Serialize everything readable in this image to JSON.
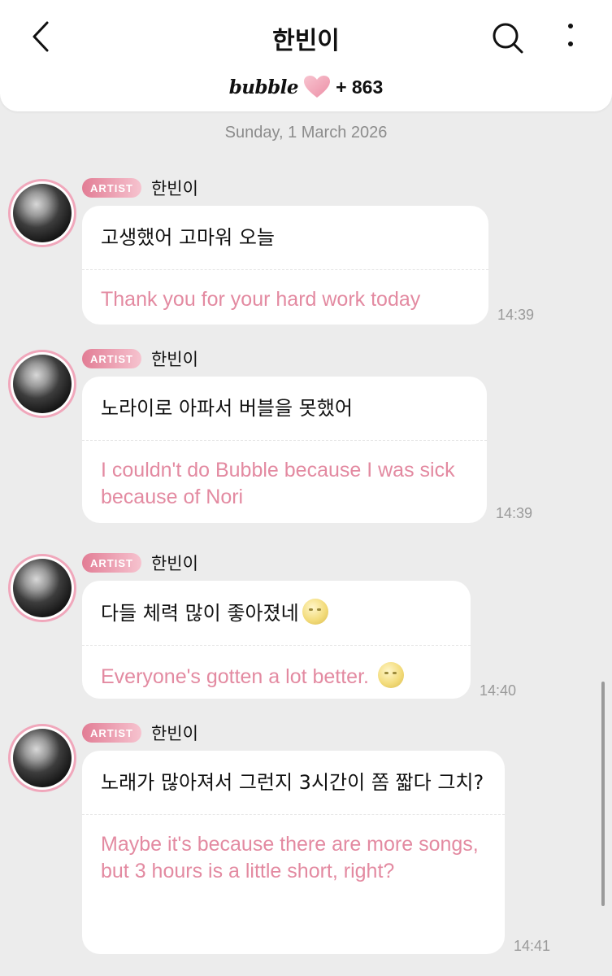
{
  "header": {
    "title": "한빈이",
    "bubble_logo": "bubble",
    "bubble_count": "+ 863",
    "heart_color": "#f4a7b9"
  },
  "date": "Sunday, 1 March 2026",
  "messages": [
    {
      "badge": "ARTIST",
      "sender": "한빈이",
      "korean": "고생했어 고마워 오늘",
      "english": "Thank you for your hard work today",
      "time": "14:39"
    },
    {
      "badge": "ARTIST",
      "sender": "한빈이",
      "korean": "노라이로 아파서 버블을 못했어",
      "english": "I couldn't do Bubble because I was sick because of Nori",
      "time": "14:39"
    },
    {
      "badge": "ARTIST",
      "sender": "한빈이",
      "korean": "다들 체력 많이 좋아졌네",
      "english": "Everyone's gotten a lot better.",
      "korean_emoji": "moon-face-emoji",
      "english_emoji": "moon-face-emoji",
      "time": "14:40"
    },
    {
      "badge": "ARTIST",
      "sender": "한빈이",
      "korean": "노래가 많아져서 그런지 3시간이 쫌 짧다 그치?",
      "english": "Maybe it's because there are more songs, but 3 hours is a little short, right?",
      "time": "14:41"
    }
  ],
  "icons": {
    "back": "chevron-left-icon",
    "search": "search-icon",
    "more": "more-vertical-icon",
    "heart": "heart-icon"
  },
  "colors": {
    "accent_pink": "#e38aa1",
    "badge_gradient_start": "#e27d95",
    "badge_gradient_end": "#f6c3cf",
    "background": "#ececec"
  }
}
